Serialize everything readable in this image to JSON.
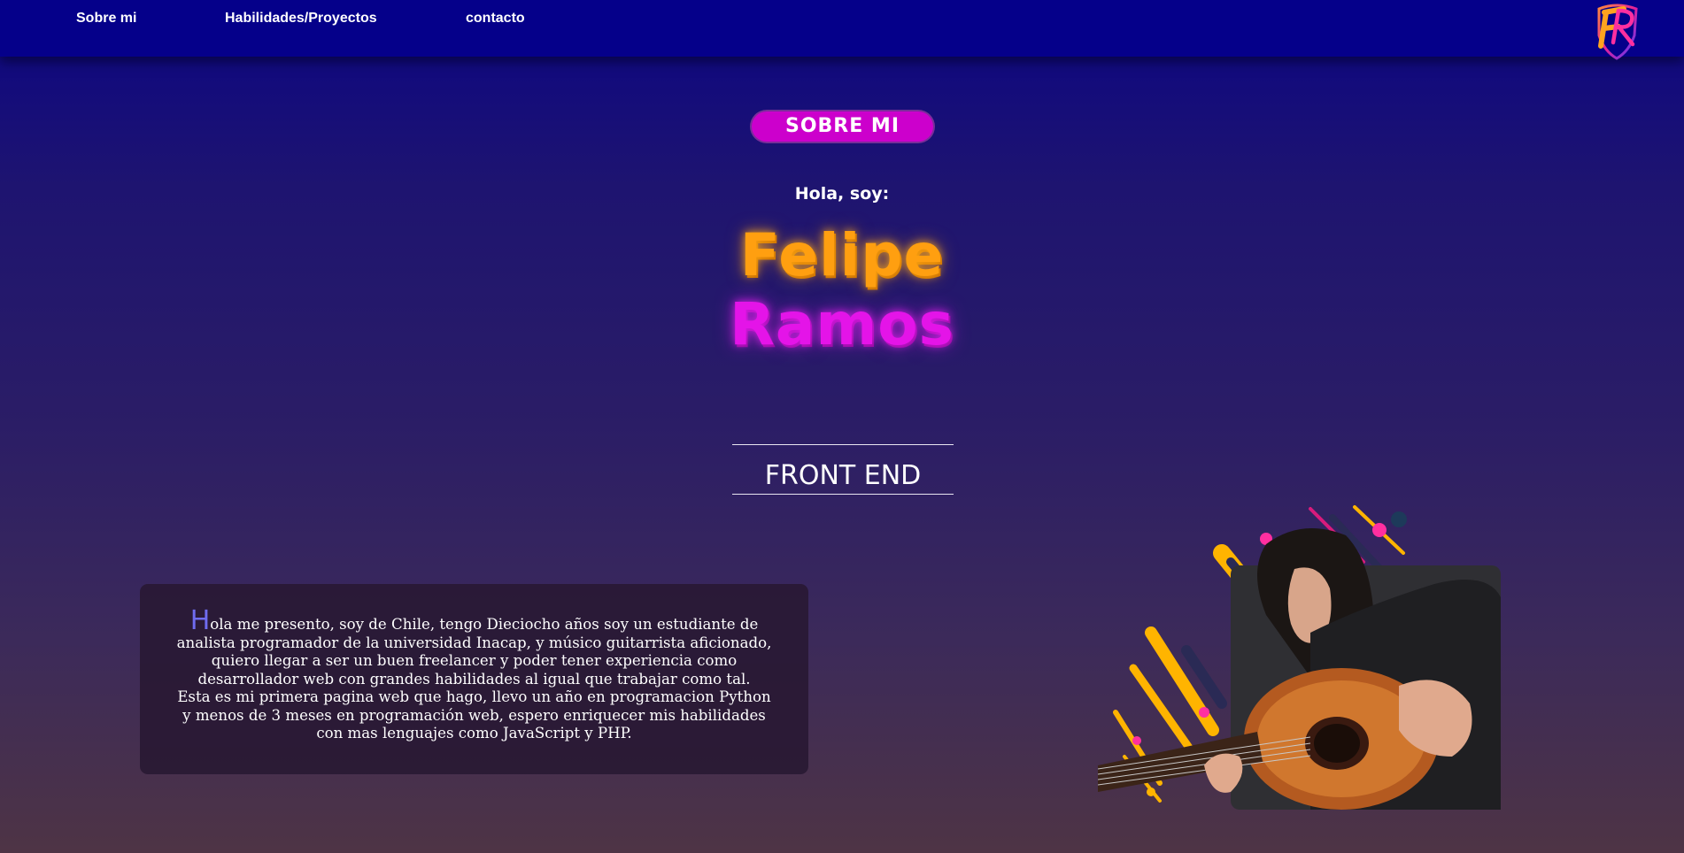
{
  "nav": {
    "links": [
      "Sobre mi",
      "Habilidades/Proyectos",
      "contacto"
    ],
    "logo_letters": "FR"
  },
  "hero": {
    "badge": "SOBRE MI",
    "greeting": "Hola, soy:",
    "first_name": "Felipe",
    "last_name": "Ramos",
    "role": "FRONT END"
  },
  "bio": {
    "initial": "H",
    "lines": [
      "ola me presento, soy de Chile, tengo Dieciocho años soy un estudiante de",
      "analista programador de la universidad Inacap, y músico guitarrista aficionado,",
      "quiero llegar a ser un buen freelancer y poder tener experiencia como",
      "desarrollador web con grandes habilidades al igual que trabajar como tal.",
      "Esta es mi primera pagina web que hago, llevo un año en programacion Python",
      "y menos de 3 meses en programación web, espero enriquecer mis habilidades",
      "con mas lenguajes como JavaScript y PHP."
    ]
  },
  "colors": {
    "nav_bg": "#05008a",
    "badge_bg": "#cc00cc",
    "first_name": "#ff9f10",
    "last_name": "#e414e8",
    "initial": "#6f6cf0"
  },
  "icons": {
    "logo": "fr-monogram-logo",
    "photo": "guitarist-photo-illustration"
  }
}
